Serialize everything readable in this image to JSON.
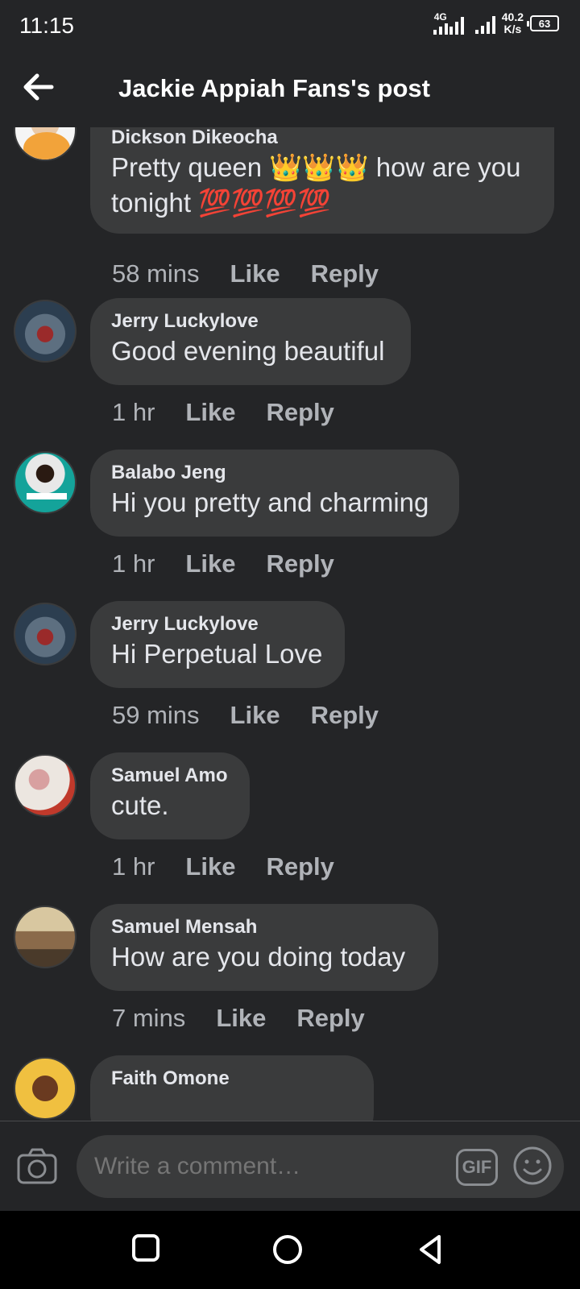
{
  "status": {
    "time": "11:15",
    "network": "4G",
    "speed_value": "40.2",
    "speed_unit": "K/s",
    "battery": "63"
  },
  "header": {
    "back_icon": "arrow-left-icon",
    "title": "Jackie Appiah Fans's post"
  },
  "comments": [
    {
      "author": "Dickson Dikeocha",
      "line1": "Pretty queen 👑👑👑 how are you",
      "line2": "tonight 💯💯💯💯",
      "time": "58 mins",
      "like": "Like",
      "reply": "Reply"
    },
    {
      "author": "Jerry Luckylove",
      "line1": "Good evening beautiful",
      "time": "1 hr",
      "like": "Like",
      "reply": "Reply"
    },
    {
      "author": "Balabo Jeng",
      "line1": "Hi you pretty and charming",
      "time": "1 hr",
      "like": "Like",
      "reply": "Reply"
    },
    {
      "author": "Jerry Luckylove",
      "line1": "Hi Perpetual Love",
      "time": "59 mins",
      "like": "Like",
      "reply": "Reply"
    },
    {
      "author": "Samuel Amo",
      "line1": "cute.",
      "time": "1 hr",
      "like": "Like",
      "reply": "Reply"
    },
    {
      "author": "Samuel Mensah",
      "line1": "How are you doing today",
      "time": "7 mins",
      "like": "Like",
      "reply": "Reply"
    },
    {
      "author": "Faith Omone"
    }
  ],
  "composer": {
    "placeholder": "Write a comment…",
    "gif_label": "GIF",
    "camera_icon": "camera-icon",
    "emoji_icon": "smiley-icon"
  },
  "navbar": {
    "recents_icon": "square-icon",
    "home_icon": "circle-icon",
    "back_icon": "triangle-back-icon"
  }
}
